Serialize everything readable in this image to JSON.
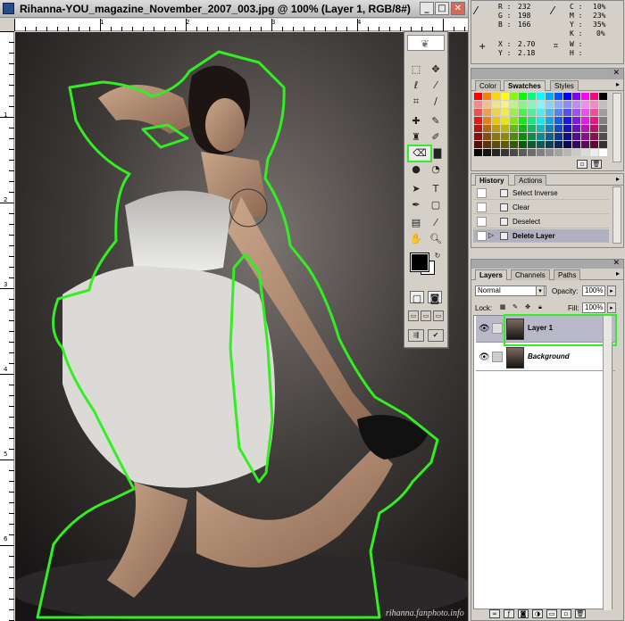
{
  "window": {
    "title": "Rihanna-YOU_magazine_November_2007_003.jpg @ 100% (Layer 1, RGB/8#)",
    "minimize": "_",
    "maximize": "□",
    "close": "✕"
  },
  "rulers": {
    "top": [
      "1",
      "2",
      "3",
      "4"
    ],
    "left": [
      "1",
      "2",
      "3",
      "4",
      "5",
      "6"
    ]
  },
  "watermark": "rihanna.fanphoto.info",
  "info": {
    "R_label": "R :",
    "R": "232",
    "G_label": "G :",
    "G": "198",
    "B_label": "B :",
    "B": "166",
    "C_label": "C :",
    "C": "10%",
    "M_label": "M :",
    "M": "23%",
    "Y_label": "Y :",
    "Y": "35%",
    "K_label": "K :",
    "K": "0%",
    "X_label": "X :",
    "X": "2.70",
    "Yc_label": "Y :",
    "Yc": "2.18",
    "W_label": "W :",
    "W": "",
    "H_label": "H :",
    "H": ""
  },
  "swatches_panel": {
    "tabs": [
      "Color",
      "Swatches",
      "Styles"
    ],
    "active": "Swatches"
  },
  "history_panel": {
    "tabs": [
      "History",
      "Actions"
    ],
    "active": "History",
    "items": [
      "Select Inverse",
      "Clear",
      "Deselect",
      "Delete Layer"
    ]
  },
  "layers_panel": {
    "tabs": [
      "Layers",
      "Channels",
      "Paths"
    ],
    "active": "Layers",
    "blend_mode": "Normal",
    "opacity_label": "Opacity:",
    "opacity": "100%",
    "lock_label": "Lock:",
    "fill_label": "Fill:",
    "fill": "100%",
    "layers": [
      "Layer 1",
      "Background"
    ]
  },
  "toolbox": {
    "tools": [
      "rect-marquee",
      "move",
      "lasso",
      "magic-wand",
      "crop",
      "slice",
      "healing-brush",
      "brush",
      "clone-stamp",
      "history-brush",
      "eraser",
      "gradient",
      "blur",
      "dodge",
      "path-select",
      "type",
      "pen",
      "shape",
      "notes",
      "eyedropper",
      "hand",
      "zoom"
    ],
    "selected": "eraser"
  },
  "colors": {
    "selection_outline": "#33ee22",
    "foreground": "#000000",
    "background": "#ffffff"
  }
}
